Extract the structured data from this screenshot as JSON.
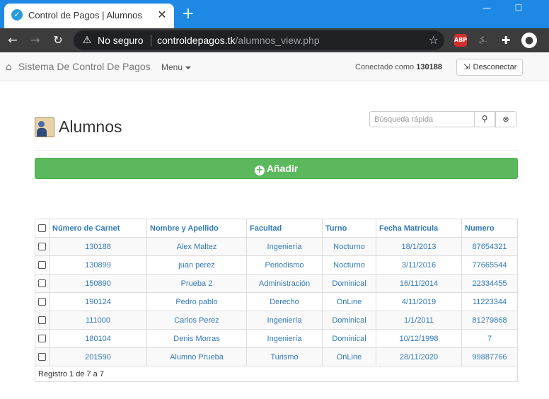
{
  "browser": {
    "tab_title": "Control de Pagos | Alumnos",
    "tab_close": "✕",
    "new_tab": "+",
    "win_minimize": "—",
    "win_maximize": "☐",
    "security_label": "No seguro",
    "url_domain": "controldepagos.tk",
    "url_path": "/alumnos_view.php",
    "ext_abp": "ABP"
  },
  "navbar": {
    "brand": "Sistema De Control De Pagos",
    "menu_label": "Menu",
    "connected_label": "Conectado como",
    "connected_user": "130188",
    "logout_label": "Desconectar"
  },
  "page": {
    "title": "Alumnos",
    "search_placeholder": "Búsqueda rápida",
    "add_label": "Añadir"
  },
  "table": {
    "headers": [
      "Número de Carnet",
      "Nombre y Apellido",
      "Facultad",
      "Turno",
      "Fecha Matricula",
      "Numero"
    ],
    "rows": [
      [
        "130188",
        "Alex Maltez",
        "Ingeniería",
        "Nocturno",
        "18/1/2013",
        "87654321"
      ],
      [
        "130899",
        "juan perez",
        "Periodismo",
        "Nocturno",
        "3/11/2016",
        "77665544"
      ],
      [
        "150890",
        "Prueba 2",
        "Administración",
        "Dominical",
        "16/11/2014",
        "22334455"
      ],
      [
        "190124",
        "Pedro pablo",
        "Derecho",
        "OnLine",
        "4/11/2019",
        "11223344"
      ],
      [
        "111000",
        "Carlos Perez",
        "Ingeniería",
        "Dominical",
        "1/1/2011",
        "81279868"
      ],
      [
        "180104",
        "Denis Morras",
        "Ingeniería",
        "Dominical",
        "10/12/1998",
        "7"
      ],
      [
        "201590",
        "Alumno Prueba",
        "Turismo",
        "OnLine",
        "28/11/2020",
        "99887766"
      ]
    ],
    "footer": "Registro 1 de 7 a 7"
  },
  "colors": {
    "titlebar": "#1e88e5",
    "link": "#337ab7",
    "success": "#5cb85c"
  }
}
